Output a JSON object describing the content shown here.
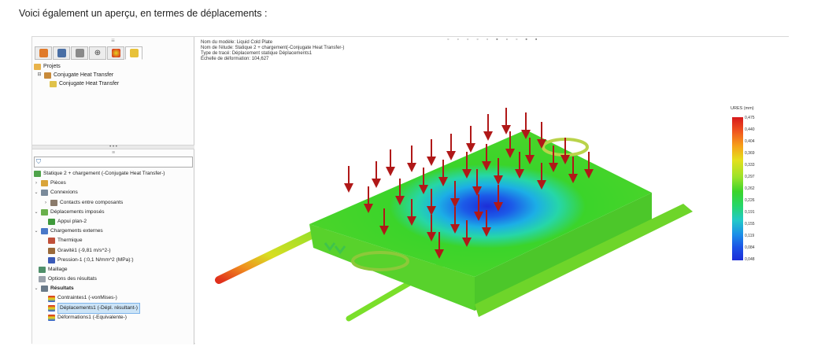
{
  "caption": "Voici également un aperçu, en termes de déplacements :",
  "tabs": [
    "study-tab-1",
    "study-tab-2",
    "study-tab-3",
    "study-tab-4",
    "study-tab-5",
    "study-tab-6"
  ],
  "projects": {
    "root": "Projets",
    "item1": "Conjugate Heat Transfer",
    "item2": "Conjugate Heat Transfer"
  },
  "filter_label": "",
  "study": {
    "title": "Statique 2 + chargement (-Conjugate Heat Transfer-)",
    "parts": "Pièces",
    "connections": "Connexions",
    "contacts": "Contacts entre composants",
    "fixtures": "Déplacements imposés",
    "fixture_item": "Appui plan-2",
    "loads": "Chargements externes",
    "thermal": "Thermique",
    "gravity": "Gravité1 (-9,81 m/s^2-)",
    "pressure": "Pression-1 (:0,1 N/mm^2 (MPa):)",
    "mesh": "Maillage",
    "options": "Options des résultats",
    "results": "Résultats",
    "res_stress": "Contraintes1 (-vonMises-)",
    "res_disp": "Déplacements1 (-Dépl. résultant-)",
    "res_strain": "Déformations1 (-Equivalente-)"
  },
  "graphics_info": {
    "line1": "Nom du modèle: Liquid Cold Plate",
    "line2": "Nom de l'étude: Statique 2 + chargement(-Conjugate Heat Transfer-)",
    "line3": "Type de tracé: Déplacement statique Déplacements1",
    "line4": "Échelle de déformation: 104,627"
  },
  "legend": {
    "title": "URES (mm)",
    "ticks": [
      "0,475",
      "0,440",
      "0,404",
      "0,369",
      "0,333",
      "0,297",
      "0,262",
      "0,226",
      "0,191",
      "0,155",
      "0,119",
      "0,084",
      "0,048"
    ]
  },
  "colors": {
    "accent_blue": "#1c2ed8",
    "accent_red": "#d7191c",
    "plate_green": "#39d12a",
    "arrow_red": "#b01818"
  }
}
